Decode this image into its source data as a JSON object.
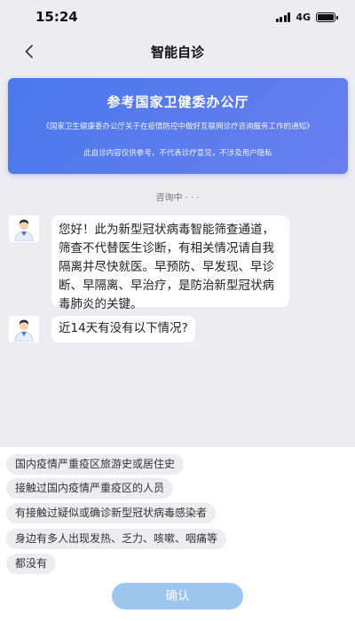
{
  "status_bar": {
    "time": "15:24",
    "network": "4G"
  },
  "nav": {
    "title": "智能自诊"
  },
  "banner": {
    "title": "参考国家卫健委办公厅",
    "subtitle": "《国家卫生健康委办公厅关于在疫情防控中做好互联网诊疗咨询服务工作的通知》",
    "note": "此自诊内容仅供参考，不代表诊疗意见，不涉及用户隐私"
  },
  "consulting_label": "咨询中 · · ·",
  "messages": [
    {
      "text": "您好！此为新型冠状病毒智能筛查通道，筛查不代替医生诊断，有相关情况请自我隔离并尽快就医。早预防、早发现、早诊断、早隔离、早治疗，是防治新型冠状病毒肺炎的关键。"
    },
    {
      "text": "近14天有没有以下情况?"
    }
  ],
  "options": [
    {
      "label": "国内疫情严重疫区旅游史或居住史"
    },
    {
      "label": "接触过国内疫情严重疫区的人员"
    },
    {
      "label": "有接触过疑似或确诊新型冠状病毒感染者"
    },
    {
      "label": "身边有多人出现发热、乏力、咳嗽、咽痛等"
    },
    {
      "label": "都没有"
    }
  ],
  "confirm_label": "确认",
  "colors": {
    "banner": "#5a7cee",
    "confirm": "#9dc6ef",
    "background": "#ececf1"
  },
  "icons": {
    "back": "chevron-left-icon",
    "avatar": "doctor-avatar-icon"
  }
}
